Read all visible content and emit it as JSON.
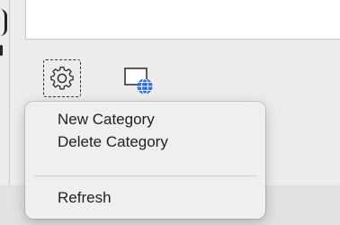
{
  "toolbar": {
    "settings_icon": "gear-icon",
    "web_document_icon": "globe-document-icon"
  },
  "context_menu": {
    "items": [
      {
        "label": "New Category"
      },
      {
        "label": "Delete Category"
      },
      {
        "label": "Refresh"
      }
    ]
  },
  "colors": {
    "menu_background": "#efefef",
    "globe_accent": "#2f6fd6"
  }
}
